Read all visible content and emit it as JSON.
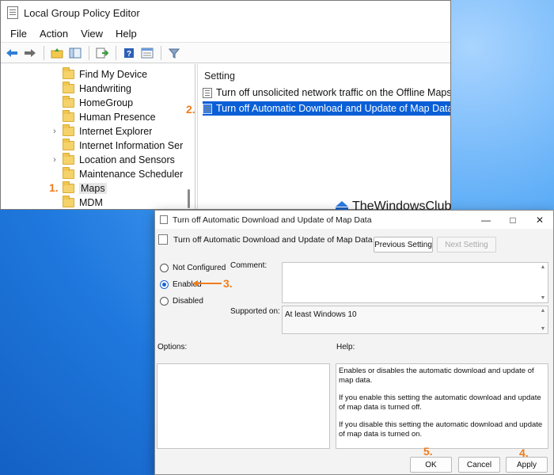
{
  "editor": {
    "title": "Local Group Policy Editor",
    "menu": [
      "File",
      "Action",
      "View",
      "Help"
    ],
    "toolbar_icons": [
      "back-arrow-icon",
      "forward-arrow-icon",
      "up-folder-icon",
      "show-hide-tree-icon",
      "export-list-icon",
      "help-icon",
      "properties-icon",
      "filter-icon"
    ],
    "tree_items": [
      {
        "label": "Find My Device",
        "expandable": false,
        "selected": false
      },
      {
        "label": "Handwriting",
        "expandable": false,
        "selected": false
      },
      {
        "label": "HomeGroup",
        "expandable": false,
        "selected": false
      },
      {
        "label": "Human Presence",
        "expandable": false,
        "selected": false
      },
      {
        "label": "Internet Explorer",
        "expandable": true,
        "selected": false
      },
      {
        "label": "Internet Information Ser",
        "expandable": false,
        "selected": false
      },
      {
        "label": "Location and Sensors",
        "expandable": true,
        "selected": false
      },
      {
        "label": "Maintenance Scheduler",
        "expandable": false,
        "selected": false
      },
      {
        "label": "Maps",
        "expandable": false,
        "selected": true
      },
      {
        "label": "MDM",
        "expandable": false,
        "selected": false
      }
    ],
    "settings_header": "Setting",
    "settings": [
      {
        "label": "Turn off unsolicited network traffic on the Offline Maps s",
        "selected": false
      },
      {
        "label": "Turn off Automatic Download and Update of Map Data",
        "selected": true
      }
    ]
  },
  "annotations": {
    "step1": "1.",
    "step2": "2.",
    "step3": "3.",
    "step4": "4.",
    "step5": "5.",
    "color": "#f07c1b"
  },
  "watermark": "TheWindowsClub",
  "dialog": {
    "title": "Turn off Automatic Download and Update of Map Data",
    "header": "Turn off Automatic Download and Update of Map Data",
    "previous_setting": "Previous Setting",
    "next_setting": "Next Setting",
    "options": [
      {
        "label": "Not Configured",
        "checked": false
      },
      {
        "label": "Enabled",
        "checked": true
      },
      {
        "label": "Disabled",
        "checked": false
      }
    ],
    "comment_label": "Comment:",
    "comment_value": "",
    "supported_on_label": "Supported on:",
    "supported_on_value": "At least Windows 10",
    "options_label": "Options:",
    "help_label": "Help:",
    "help_paragraphs": [
      "Enables or disables the automatic download and update of map data.",
      "If you enable this setting the automatic download and update of map data is turned off.",
      "If you disable this setting the automatic download and update of map data is turned on."
    ],
    "ok": "OK",
    "cancel": "Cancel",
    "apply": "Apply",
    "accent": "#1a63d6"
  }
}
